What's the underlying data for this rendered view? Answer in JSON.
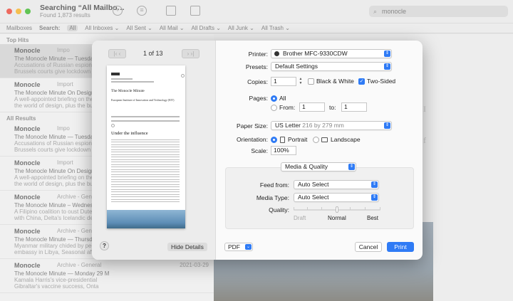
{
  "window": {
    "title": "Searching “All Mailbo…",
    "subtitle": "Found 1,873 results",
    "search_value": "monocle"
  },
  "scopebar": {
    "mailboxes": "Mailboxes",
    "search_label": "Search:",
    "scopes": [
      "All",
      "All Inboxes ⌄",
      "All Sent ⌄",
      "All Mail ⌄",
      "All Drafts ⌄",
      "All Junk ⌄",
      "All Trash ⌄"
    ]
  },
  "messages": {
    "top_hits_label": "Top Hits",
    "all_results_label": "All Results",
    "top_hits": [
      {
        "from": "Monocle",
        "tag": "Impo",
        "date": "",
        "subject": "The Monocle Minute — Tuesday 1",
        "preview1": "Accusations of Russian espionage",
        "preview2": "Brussels courts give lockdown all"
      },
      {
        "from": "Monocle",
        "tag": "Import",
        "date": "",
        "subject": "The Monocle Minute On Design —",
        "preview1": "A well-appointed briefing on the",
        "preview2": "the world of design, plus the build"
      }
    ],
    "all_results": [
      {
        "from": "Monocle",
        "tag": "Impo",
        "date": "",
        "subject": "The Monocle Minute — Tuesday 1",
        "preview1": "Accusations of Russian espionage",
        "preview2": "Brussels courts give lockdown all"
      },
      {
        "from": "Monocle",
        "tag": "Import",
        "date": "",
        "subject": "The Monocle Minute On Design —",
        "preview1": "A well-appointed briefing on the",
        "preview2": "the world of design, plus the build"
      },
      {
        "from": "Monocle",
        "tag": "Archive - Gene",
        "date": "",
        "subject": "The Monocle Minute – Wednesday",
        "preview1": "A Filipino coalition to oust Duter",
        "preview2": "with China, Delta's Icelandic dest"
      },
      {
        "from": "Monocle",
        "tag": "Archive - Gener",
        "date": "",
        "subject": "The Monocle Minute — Thursday 1",
        "preview1": "Myanmar military chided by peers",
        "preview2": "embassy in Libya, Seasonal affect"
      },
      {
        "from": "Monocle",
        "tag": "Archive - General",
        "date": "2021-03-29",
        "subject": "The Monocle Minute — Monday 29 M",
        "preview1": "Kamala Harris's vice-presidential",
        "preview2": "Gibraltar's vaccine success, Onta"
      }
    ]
  },
  "print": {
    "page_indicator": "1 of 13",
    "preview": {
      "masthead": "The Monocle Minute",
      "headline_small": "European Institute of Innovation and Technology (EIT)",
      "headline": "Under the influence"
    },
    "labels": {
      "printer": "Printer:",
      "presets": "Presets:",
      "copies": "Copies:",
      "pages": "Pages:",
      "from": "From:",
      "to": "to:",
      "paper_size": "Paper Size:",
      "orientation": "Orientation:",
      "scale": "Scale:",
      "feed_from": "Feed from:",
      "media_type": "Media Type:",
      "quality": "Quality:"
    },
    "printer": "Brother MFC-9330CDW",
    "presets": "Default Settings",
    "copies": "1",
    "black_white": "Black & White",
    "two_sided": "Two-Sided",
    "pages_all": "All",
    "from_value": "1",
    "to_value": "1",
    "paper_size": "US Letter",
    "paper_dims": "216 by 279 mm",
    "portrait": "Portrait",
    "landscape": "Landscape",
    "scale": "100%",
    "section": "Media & Quality",
    "feed_from": "Auto Select",
    "media_type": "Auto Select",
    "quality_draft": "Draft",
    "quality_normal": "Normal",
    "quality_best": "Best",
    "quality_level": 0.5,
    "help": "?",
    "hide_details": "Hide Details",
    "pdf": "PDF",
    "cancel": "Cancel",
    "print": "Print"
  }
}
